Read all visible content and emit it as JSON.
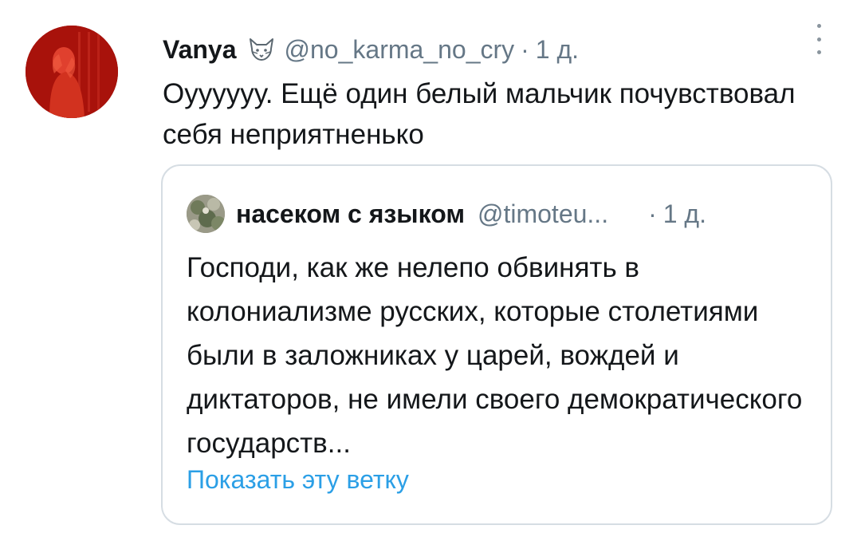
{
  "tweet": {
    "author_name": "Vanya",
    "author_badge_icon": "fox-emoji",
    "handle": "@no_karma_no_cry",
    "separator": "·",
    "time": "1 д.",
    "text": "Оуууууу. Ещё один белый мальчик почувствовал себя неприятненько"
  },
  "quote": {
    "author_name": "насеком с языком",
    "handle": "@timoteu...",
    "separator": "·",
    "time": "1 д.",
    "text": "Господи, как же нелепо обвинять в колониализме русских, которые столетиями были в заложниках у царей, вождей и диктаторов, не имели своего демократического государств...",
    "show_thread_label": "Показать эту ветку"
  },
  "colors": {
    "link": "#2b9fe6",
    "secondary_text": "#657786",
    "border": "#d6dde3",
    "avatar_red": "#c21a12"
  }
}
